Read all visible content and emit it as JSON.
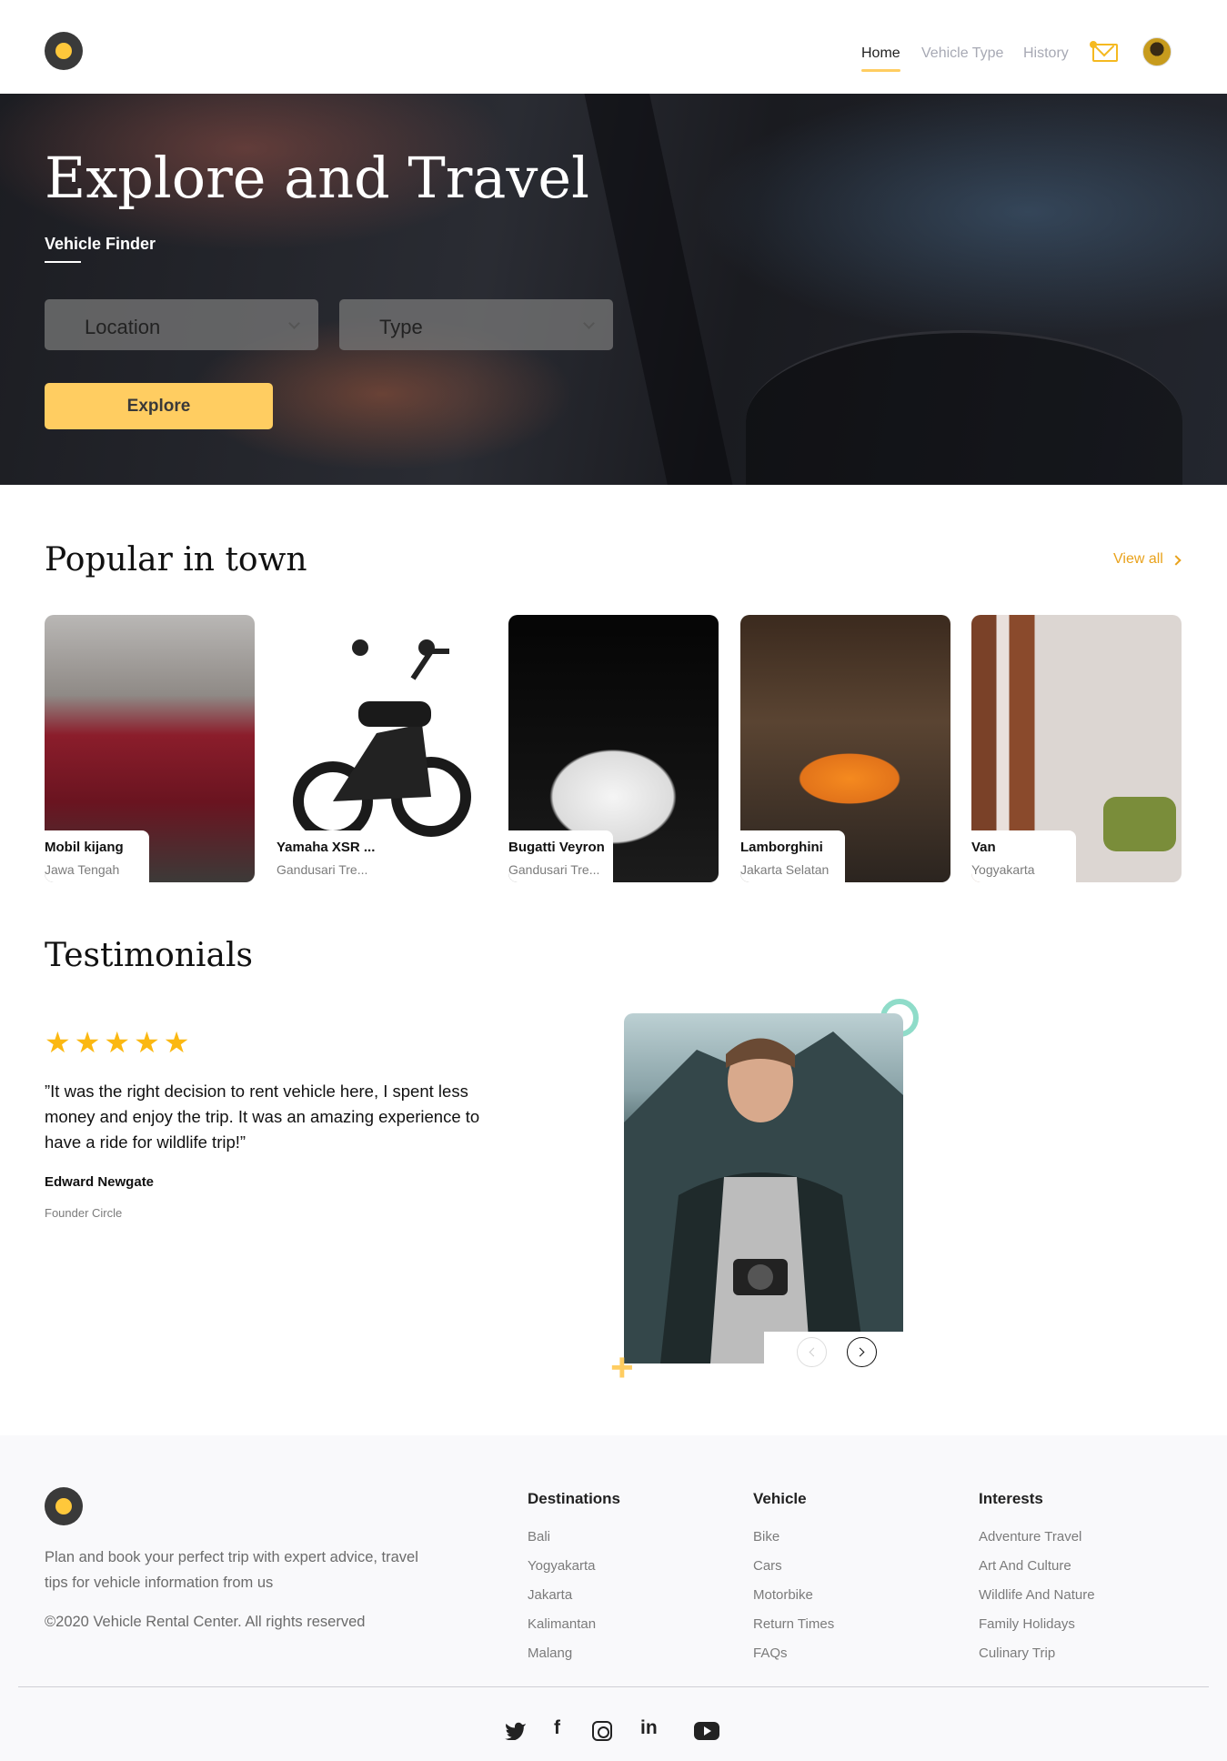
{
  "nav": {
    "links": [
      "Home",
      "Vehicle Type",
      "History"
    ],
    "active": "Home"
  },
  "hero": {
    "title": "Explore and Travel",
    "subtitle": "Vehicle Finder",
    "location_label": "Location",
    "type_label": "Type",
    "explore_label": "Explore"
  },
  "popular": {
    "title": "Popular in town",
    "view_all": "View all",
    "cards": [
      {
        "name": "Mobil kijang",
        "location": "Jawa Tengah",
        "color": "#8b1d2b"
      },
      {
        "name": "Yamaha XSR ...",
        "location": "Gandusari Tre...",
        "color": "#1a1a1a"
      },
      {
        "name": "Bugatti Veyron",
        "location": "Gandusari Tre...",
        "color": "#f0f0f0"
      },
      {
        "name": "Lamborghini",
        "location": "Jakarta Selatan",
        "color": "#f58a1f"
      },
      {
        "name": "Van",
        "location": "Yogyakarta",
        "color": "#7a8d3a"
      }
    ]
  },
  "testimonials": {
    "title": "Testimonials",
    "rating": 5,
    "quote": "”It was the right decision to rent vehicle here, I spent less money and enjoy the trip. It was an amazing experience to have a ride for wildlife trip!”",
    "name": "Edward Newgate",
    "role": "Founder Circle"
  },
  "footer": {
    "description": "Plan and book your perfect trip with expert advice, travel tips for vehicle information from us",
    "copyright": "©2020 Vehicle Rental Center. All rights reserved",
    "columns": [
      {
        "title": "Destinations",
        "items": [
          "Bali",
          "Yogyakarta",
          "Jakarta",
          "Kalimantan",
          "Malang"
        ]
      },
      {
        "title": "Vehicle",
        "items": [
          "Bike",
          "Cars",
          "Motorbike",
          "Return Times",
          "FAQs"
        ]
      },
      {
        "title": "Interests",
        "items": [
          "Adventure Travel",
          "Art And Culture",
          "Wildlife And Nature",
          "Family Holidays",
          "Culinary Trip"
        ]
      }
    ],
    "socials": [
      "twitter-icon",
      "facebook-icon",
      "instagram-icon",
      "linkedin-icon",
      "youtube-icon"
    ]
  },
  "colors": {
    "accent": "#ffcd61",
    "link": "#e9a21c",
    "star": "#fbb812"
  }
}
